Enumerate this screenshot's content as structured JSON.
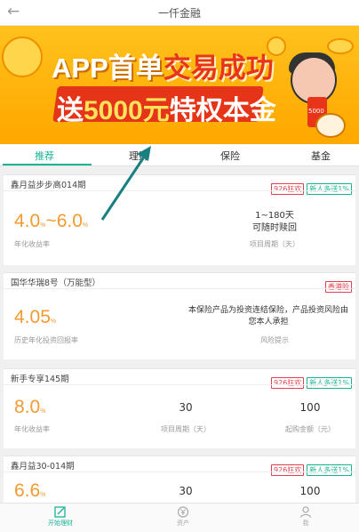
{
  "header": {
    "back_icon": "back-arrow-icon",
    "title": "一仟金融"
  },
  "banner": {
    "line1_prefix": "APP首单",
    "line1_highlight": "交易成功",
    "line2_prefix": "送",
    "line2_highlight": "5000元",
    "line2_suffix": "特权本金",
    "phone_text": "5000",
    "carousel_total": 4,
    "carousel_active_index": 2
  },
  "tabs": [
    {
      "label": "推荐",
      "active": true
    },
    {
      "label": "理财",
      "active": false
    },
    {
      "label": "保险",
      "active": false
    },
    {
      "label": "基金",
      "active": false
    }
  ],
  "products": [
    {
      "name": "鑫月益步步高014期",
      "badges": [
        "926狂欢",
        "新人多送1%"
      ],
      "rate": "4.0%~6.0%",
      "rate_main": "4.0",
      "rate_pct": "%",
      "rate_sep": "~",
      "rate_main2": "6.0",
      "rate_pct2": "%",
      "rate_label": "年化收益率",
      "col2_value_line1": "1~180天",
      "col2_value_line2": "可随时赎回",
      "col2_label": "项目周期（天）"
    },
    {
      "name": "国华华瑞8号（万能型）",
      "badges": [
        "香港险"
      ],
      "rate_main": "4.05",
      "rate_pct": "%",
      "rate_label": "历史年化投资回报率",
      "col2_value_line1": "本保险产品为投资连结保险，产品投资风险由",
      "col2_value_line2": "您本人承担",
      "col2_label": "风险提示"
    },
    {
      "name": "新手专享145期",
      "badges": [
        "926狂欢",
        "新人多送1%"
      ],
      "rate_main": "8.0",
      "rate_pct": "%",
      "rate_label": "年化收益率",
      "col2_value": "30",
      "col2_label": "项目周期（天）",
      "col3_value": "100",
      "col3_label": "起购金额（元）"
    },
    {
      "name": "鑫月益30-014期",
      "badges": [
        "926狂欢",
        "新人多送1%"
      ],
      "rate_main": "6.6",
      "rate_pct": "%",
      "col2_value": "30",
      "col3_value": "100"
    }
  ],
  "bottom_nav": [
    {
      "label": "开始理财",
      "icon": "edit-icon",
      "active": true
    },
    {
      "label": "资产",
      "icon": "yen-icon",
      "active": false
    },
    {
      "label": "我",
      "icon": "user-icon",
      "active": false
    }
  ],
  "colors": {
    "accent_green": "#19b395",
    "rate_orange": "#f39a32",
    "badge_red": "#e0434f",
    "banner_yellow": "#ffb10a"
  },
  "annotation": {
    "type": "arrow",
    "color": "#1a7f80",
    "points_to": "tab-licai"
  }
}
